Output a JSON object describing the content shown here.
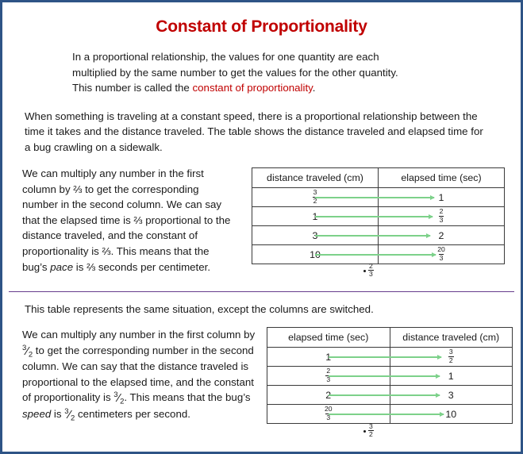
{
  "page": {
    "border_color": "#2E5486",
    "divider_color": "#663C8C",
    "title_color": "#C00000",
    "arrow_color": "#7DD18A"
  },
  "title": "Constant of Proportionality",
  "intro": {
    "line1": "In a proportional  relationship, the  values for one  quantity are each",
    "line2": "multiplied by the same number  to get the values for the other  quantity.",
    "line3_prefix": "This number  is called the ",
    "line3_accent": "constant of proportionality",
    "line3_suffix": "."
  },
  "context": {
    "text": "When something is traveling at a constant speed, there is a proportional  relationship between the time it takes and the distance traveled. The table shows the distance traveled and elapsed time for a bug crawling on  a sidewalk."
  },
  "section_one": {
    "side_text": {
      "p1": "We can multiply any number  in the first column by  ⅔  to get the corresponding number  in the second column.  We can say that the elapsed time is ⅔ proportional  to the distance traveled, and the constant of proportionality is ⅔. This means that the bug’s ",
      "emphasis": "pace",
      "p2": " is ⅔ seconds per centimeter."
    },
    "table": {
      "headers": [
        "distance traveled (cm)",
        "elapsed time (sec)"
      ],
      "rows": [
        {
          "left": "3/2",
          "left_kind": "frac",
          "right": "1",
          "right_kind": "int"
        },
        {
          "left": "1",
          "left_kind": "int",
          "right": "2/3",
          "right_kind": "frac"
        },
        {
          "left": "3",
          "left_kind": "int",
          "right": "2",
          "right_kind": "int"
        },
        {
          "left": "10",
          "left_kind": "int",
          "right": "20/3",
          "right_kind": "frac"
        }
      ]
    },
    "multiplier": {
      "numerator": "2",
      "denominator": "3"
    }
  },
  "section_two": {
    "intro": "This table represents the same situation, except the columns are switched.",
    "side_text": {
      "p1a": "We can multiply any number  in the first column by ",
      "f1": {
        "numerator": "3",
        "denominator": "2"
      },
      "p1b": " to get the corresponding number  in the second column.  We can say that the distance traveled is proportional to the elapsed time, and the constant of proportionality  is ",
      "f2": {
        "numerator": "3",
        "denominator": "2"
      },
      "p1c": ". This means that the bug’s ",
      "emphasis": "speed",
      "p1d": " is ",
      "f3": {
        "numerator": "3",
        "denominator": "2"
      },
      "p1e": " centimeters per second."
    },
    "table": {
      "headers": [
        "elapsed time (sec)",
        "distance traveled (cm)"
      ],
      "rows": [
        {
          "left": "1",
          "left_kind": "int",
          "right": "3/2",
          "right_kind": "frac"
        },
        {
          "left": "2/3",
          "left_kind": "frac",
          "right": "1",
          "right_kind": "int"
        },
        {
          "left": "2",
          "left_kind": "int",
          "right": "3",
          "right_kind": "int"
        },
        {
          "left": "20/3",
          "left_kind": "frac",
          "right": "10",
          "right_kind": "int"
        }
      ]
    },
    "multiplier": {
      "numerator": "3",
      "denominator": "2"
    }
  }
}
